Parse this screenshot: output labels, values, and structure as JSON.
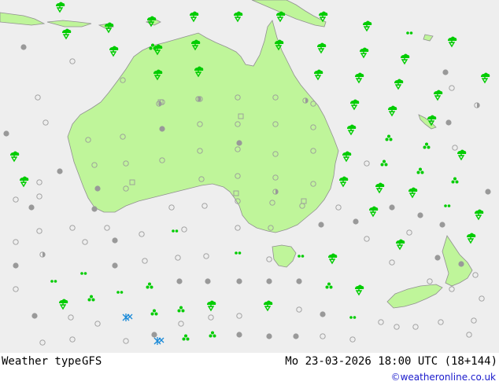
{
  "header": {
    "map_title": "Weather type",
    "model": "GFS",
    "valid_time": "Mo 23-03-2026 18:00 UTC (18+144)",
    "credit": "©weatheronline.co.uk"
  },
  "colors": {
    "sea": "#eeeeee",
    "land": "#bff59a",
    "coast": "#909090",
    "rain": "#00cc00",
    "snow": "#1a8ad8",
    "cloud_dark": "#999999",
    "cloud_outline": "#9a9a9a"
  },
  "legend_symbols": [
    "rain-shower",
    "drizzle",
    "showers",
    "snow",
    "overcast",
    "partly-cloudy",
    "clear"
  ]
}
